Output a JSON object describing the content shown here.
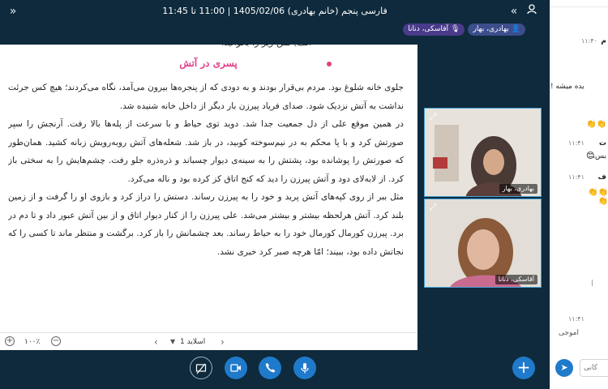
{
  "header": {
    "title": "فارسی پنجم (خانم بهادری) 1405/02/06 | 11:00 تا 11:45",
    "expand_icon": "chevron-right-double-icon",
    "user_icon": "user-add-icon"
  },
  "participants": [
    {
      "label": "بهادری، بهار",
      "icon": "person-icon"
    },
    {
      "label": "آقاسکی، دنانا",
      "icon": "mic-icon"
    }
  ],
  "document": {
    "prompt": "الف) متن زیر را بخوانید.",
    "heading": "پسری در آتش",
    "paragraphs": [
      "جلوی خانه شلوغ بود. مردم بی‌قرار بودند و به دودی که از پنجره‌ها بیرون می‌آمد، نگاه می‌کردند؛ هیچ کس جرئت نداشت به آتش نزدیک شود. صدای فریاد پیرزن بار دیگر از داخل خانه شنیده شد.",
      "در همین موقع علی از دل جمعیت جدا شد. دوید توی حیاط و با سرعت از پله‌ها بالا رفت. آرنجش را سپر صورتش کرد و با پا محکم به در نیم‌سوخته کوبید، در باز شد. شعله‌های آتش روبه‌رویش زبانه کشید. همان‌طور که صورتش را پوشانده بود، پشتش را به سینه‌ی دیوار چسباند و ذره‌ذره جلو رفت. چشم‌هایش را به سختی باز کرد. از لابه‌لای دود و آتش پیرزن را دید که کنج اتاق کز کرده بود و ناله می‌کرد.",
      "مثل ببر از روی کپه‌های آتش پرید و خود را به پیرزن رساند. دستش را دراز کرد و بازوی او را گرفت و از زمین بلند کرد. آتش هرلحظه بیشتر و بیشتر می‌شد. علی پیرزن را از کنار دیوار اتاق و از بین آتش عبور داد و تا دم در برد. پیرزن کورمال کورمال خود را به حیاط رساند. بعد چشمانش را باز کرد. برگشت و منتظر ماند تا کسی را که نجاتش داده بود، ببیند؛ امّا هرچه صبر کرد خبری نشد."
    ]
  },
  "slidebar": {
    "slide_label": "اسلاید 1",
    "zoom": "۱۰۰٪"
  },
  "cameras": [
    {
      "label": "بهادری، بهار"
    },
    {
      "label": "آقاسکی، دنانا"
    }
  ],
  "controls": [
    {
      "icon": "screen-share-off-icon"
    },
    {
      "icon": "video-camera-icon"
    },
    {
      "icon": "phone-icon"
    },
    {
      "icon": "microphone-icon"
    },
    {
      "icon": "plus-icon"
    }
  ],
  "chat": {
    "messages": [
      {
        "text": "م",
        "time": "۱۱:۴۰"
      },
      {
        "text": "یده میشه !",
        "time": ""
      },
      {
        "text": "ت",
        "time": "۱۱:۴۱"
      },
      {
        "text": "بس،",
        "time": ""
      },
      {
        "text": "ف",
        "time": "۱۱:۴۱"
      }
    ],
    "time_bottom": "۱۱:۴۱",
    "name_bottom": "اموجی",
    "input_placeholder": "کانی",
    "send_icon": "send-icon"
  }
}
